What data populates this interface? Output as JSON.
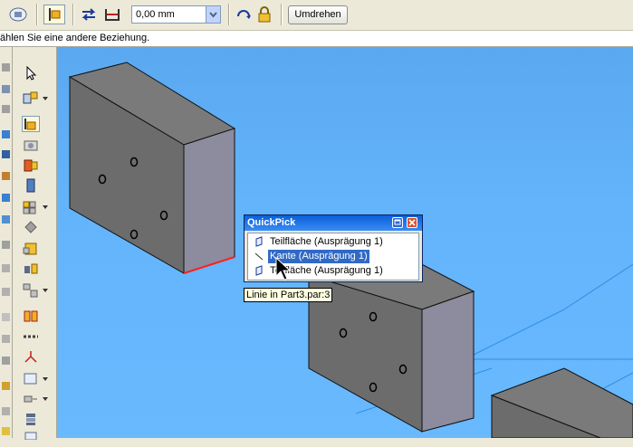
{
  "toolbar": {
    "distance_value": "0,00 mm",
    "flip_label": "Umdrehen"
  },
  "prompt": {
    "text": "ählen Sie eine andere Beziehung."
  },
  "quickpick": {
    "title": "QuickPick",
    "items": [
      {
        "label": "Teilfläche (Ausprägung 1)",
        "icon": "face-icon"
      },
      {
        "label": "Kante (Ausprägung 1)",
        "icon": "edge-icon",
        "selected": true
      },
      {
        "label": "Teilfläche (Ausprägung 1)",
        "icon": "face-icon"
      }
    ]
  },
  "tooltip": {
    "text": "Linie in Part3.par:3"
  },
  "colors": {
    "viewport_blue": "#63b4fb",
    "selection_blue": "#316ac5",
    "highlight_edge": "#ff2020",
    "titlebar_blue": "#0a5fd8"
  }
}
